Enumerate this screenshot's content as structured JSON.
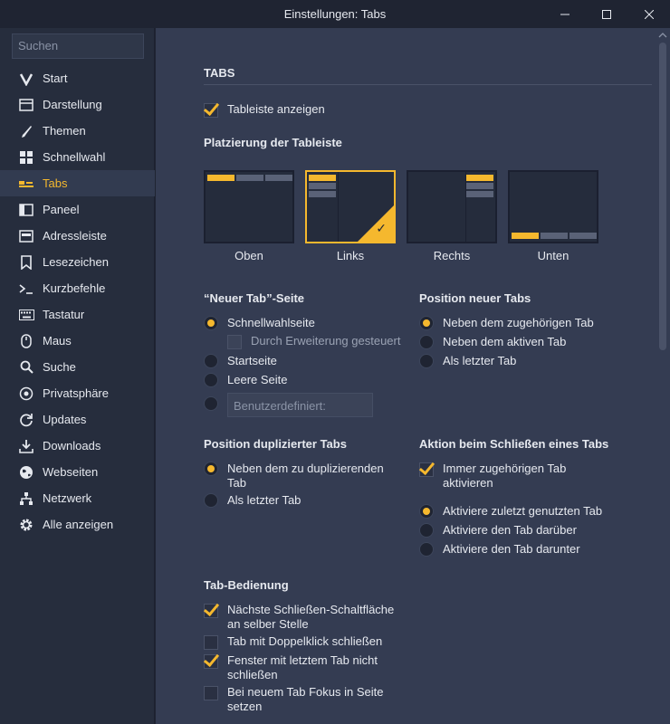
{
  "window": {
    "title": "Einstellungen: Tabs"
  },
  "sidebar": {
    "search_placeholder": "Suchen",
    "items": [
      {
        "label": "Start",
        "icon": "vivaldi-logo-icon"
      },
      {
        "label": "Darstellung",
        "icon": "window-icon"
      },
      {
        "label": "Themen",
        "icon": "brush-icon"
      },
      {
        "label": "Schnellwahl",
        "icon": "grid-icon"
      },
      {
        "label": "Tabs",
        "icon": "tabs-icon",
        "active": true
      },
      {
        "label": "Paneel",
        "icon": "panel-icon"
      },
      {
        "label": "Adressleiste",
        "icon": "address-bar-icon"
      },
      {
        "label": "Lesezeichen",
        "icon": "bookmark-icon"
      },
      {
        "label": "Kurzbefehle",
        "icon": "terminal-icon"
      },
      {
        "label": "Tastatur",
        "icon": "keyboard-icon"
      },
      {
        "label": "Maus",
        "icon": "mouse-icon"
      },
      {
        "label": "Suche",
        "icon": "search-icon"
      },
      {
        "label": "Privatsphäre",
        "icon": "shield-icon"
      },
      {
        "label": "Updates",
        "icon": "refresh-icon"
      },
      {
        "label": "Downloads",
        "icon": "download-icon"
      },
      {
        "label": "Webseiten",
        "icon": "globe-icon"
      },
      {
        "label": "Netzwerk",
        "icon": "network-icon"
      },
      {
        "label": "Alle anzeigen",
        "icon": "gear-icon"
      }
    ]
  },
  "main": {
    "heading": "TABS",
    "show_tabbar": {
      "label": "Tableiste anzeigen",
      "checked": true
    },
    "placement": {
      "heading": "Platzierung der Tableiste",
      "options": [
        {
          "label": "Oben",
          "selected": false
        },
        {
          "label": "Links",
          "selected": true
        },
        {
          "label": "Rechts",
          "selected": false
        },
        {
          "label": "Unten",
          "selected": false
        }
      ]
    },
    "new_tab_page": {
      "heading": "“Neuer Tab”-Seite",
      "speed_dial": "Schnellwahlseite",
      "extension_controlled": "Durch Erweiterung gesteuert",
      "start_page": "Startseite",
      "blank_page": "Leere Seite",
      "custom_placeholder": "Benutzerdefiniert:"
    },
    "new_tab_position": {
      "heading": "Position neuer Tabs",
      "options": [
        "Neben dem zugehörigen Tab",
        "Neben dem aktiven Tab",
        "Als letzter Tab"
      ]
    },
    "duplicate_position": {
      "heading": "Position duplizierter Tabs",
      "options": [
        "Neben dem zu duplizierenden Tab",
        "Als letzter Tab"
      ]
    },
    "close_action": {
      "heading": "Aktion beim Schließen eines Tabs",
      "always_related": "Immer zugehörigen Tab aktivieren",
      "options": [
        "Aktiviere zuletzt genutzten Tab",
        "Aktiviere den Tab darüber",
        "Aktiviere den Tab darunter"
      ]
    },
    "tab_handling": {
      "heading": "Tab-Bedienung",
      "options": [
        {
          "label": "Nächste Schließen-Schaltfläche an selber Stelle",
          "checked": true
        },
        {
          "label": "Tab mit Doppelklick schließen",
          "checked": false
        },
        {
          "label": "Fenster mit letztem Tab nicht schließen",
          "checked": true
        },
        {
          "label": "Bei neuem Tab Fokus in Seite setzen",
          "checked": false
        }
      ]
    }
  },
  "colors": {
    "accent": "#f5b82e",
    "sidebar_bg": "#262d3d",
    "main_bg": "#343c52"
  }
}
